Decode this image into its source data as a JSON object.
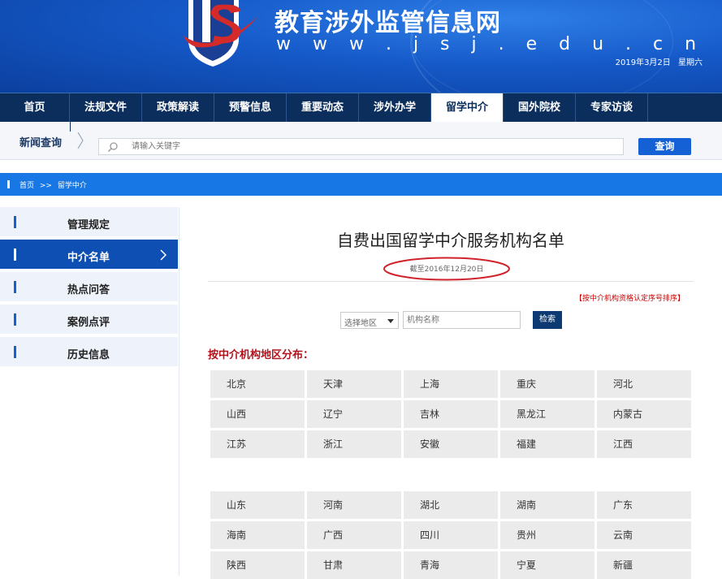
{
  "header": {
    "site_title": "教育涉外监管信息网",
    "site_url": "w w w . j s j . e d u . c n",
    "date": "2019年3月2日",
    "weekday": "星期六"
  },
  "nav": {
    "items": [
      {
        "label": "首页"
      },
      {
        "label": "法规文件"
      },
      {
        "label": "政策解读"
      },
      {
        "label": "预警信息"
      },
      {
        "label": "重要动态"
      },
      {
        "label": "涉外办学"
      },
      {
        "label": "留学中介"
      },
      {
        "label": "国外院校"
      },
      {
        "label": "专家访谈"
      }
    ],
    "active": "留学中介"
  },
  "news_search": {
    "label": "新闻查询",
    "placeholder": "请输入关键字",
    "button": "查询"
  },
  "breadcrumb": {
    "home": "首页",
    "sep": ">>",
    "current": "留学中介"
  },
  "sidebar": {
    "items": [
      {
        "label": "管理规定"
      },
      {
        "label": "中介名单"
      },
      {
        "label": "热点问答"
      },
      {
        "label": "案例点评"
      },
      {
        "label": "历史信息"
      }
    ],
    "active": "中介名单"
  },
  "main": {
    "title": "自费出国留学中介服务机构名单",
    "as_of": "截至2016年12月20日",
    "order_note": "【按中介机构资格认定序号排序】",
    "filter": {
      "region_value": "选择地区",
      "org_placeholder": "机构名称",
      "button": "检索"
    },
    "dist_heading": "按中介机构地区分布：",
    "regions_group1": [
      "北京",
      "天津",
      "上海",
      "重庆",
      "河北",
      "山西",
      "辽宁",
      "吉林",
      "黑龙江",
      "内蒙古",
      "江苏",
      "浙江",
      "安徽",
      "福建",
      "江西"
    ],
    "regions_group2": [
      "山东",
      "河南",
      "湖北",
      "湖南",
      "广东",
      "海南",
      "广西",
      "四川",
      "贵州",
      "云南",
      "陕西",
      "甘肃",
      "青海",
      "宁夏",
      "新疆"
    ]
  },
  "colors": {
    "nav_bg": "#0c2e5c",
    "accent_blue": "#1461d6",
    "crumb_bar": "#1677e5",
    "heading_red": "#b5121b",
    "oval_red": "#d0222a"
  }
}
